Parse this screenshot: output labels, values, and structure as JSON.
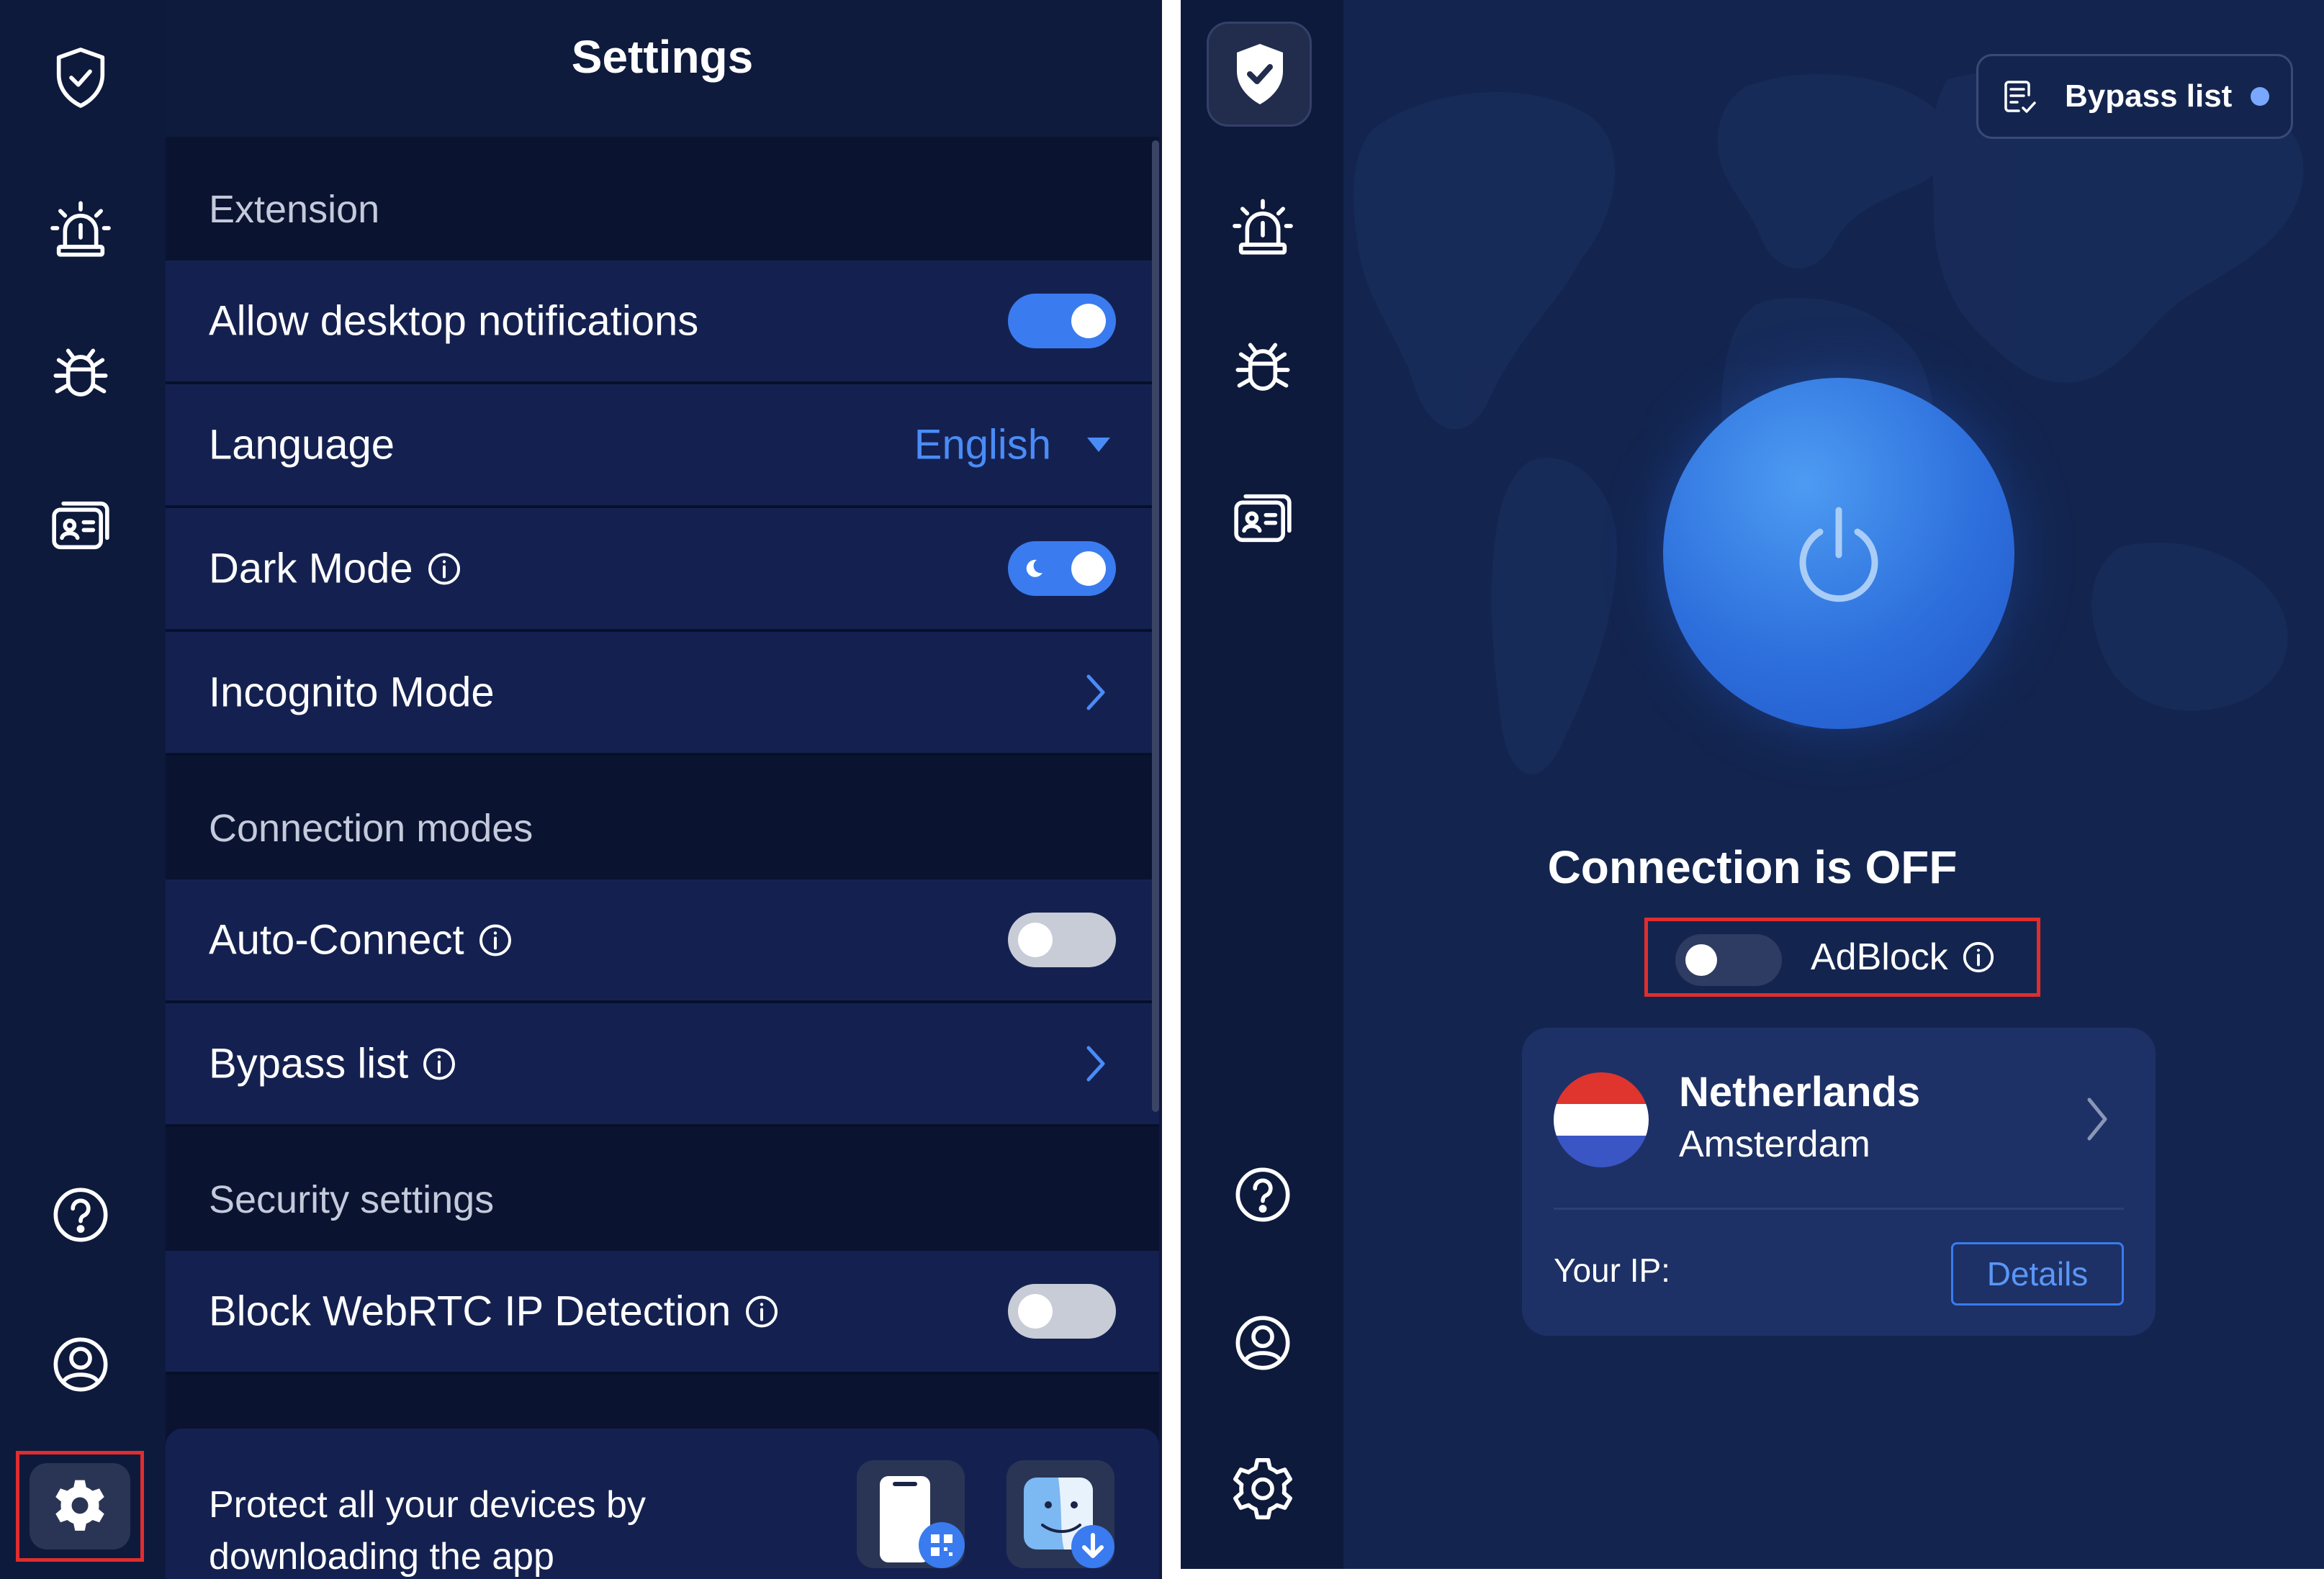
{
  "left": {
    "title": "Settings",
    "sections": {
      "extension": "Extension",
      "connection_modes": "Connection modes",
      "security": "Security settings"
    },
    "rows": {
      "notifications": {
        "label": "Allow desktop notifications",
        "enabled": true
      },
      "language": {
        "label": "Language",
        "value": "English"
      },
      "dark_mode": {
        "label": "Dark Mode",
        "enabled": true
      },
      "incognito": {
        "label": "Incognito Mode"
      },
      "auto_connect": {
        "label": "Auto-Connect",
        "enabled": false
      },
      "bypass": {
        "label": "Bypass list"
      },
      "webrtc": {
        "label": "Block WebRTC IP Detection",
        "enabled": false
      }
    },
    "promo": {
      "text": "Protect all your devices by downloading the app"
    },
    "sidebar_icons": [
      "shield-check-icon",
      "alarm-siren-icon",
      "bug-icon",
      "id-card-icon",
      "help-icon",
      "account-icon",
      "settings-icon"
    ],
    "active_item": "settings-icon"
  },
  "right": {
    "bypass_button": "Bypass list",
    "status": "Connection is OFF",
    "adblock": {
      "label": "AdBlock",
      "enabled": false
    },
    "location": {
      "country": "Netherlands",
      "city": "Amsterdam"
    },
    "ip_label": "Your IP:",
    "details_label": "Details",
    "sidebar_icons": [
      "shield-check-icon",
      "alarm-siren-icon",
      "bug-icon",
      "id-card-icon",
      "help-icon",
      "account-icon",
      "settings-icon"
    ],
    "active_item": "shield-check-icon"
  },
  "colors": {
    "accent": "#3a7bf0",
    "highlight_box": "#e02d2d",
    "panel_bg": "#0f1b3d",
    "row_bg": "#142150"
  }
}
